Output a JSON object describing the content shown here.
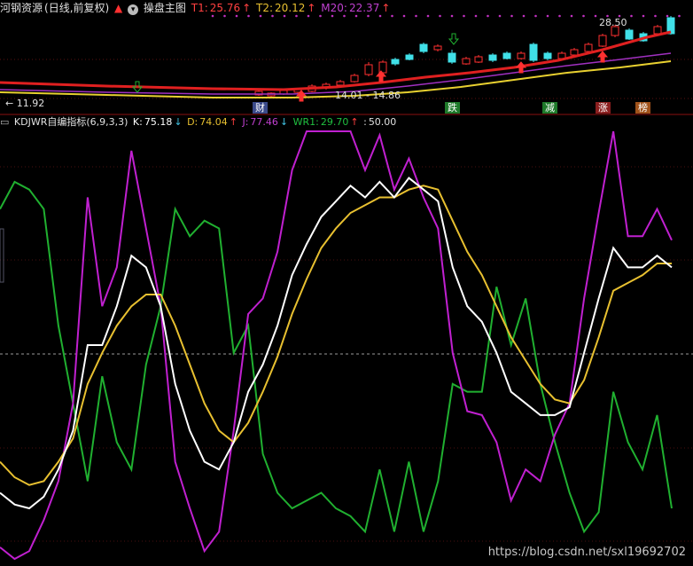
{
  "header": {
    "title": "河钢资源",
    "period": "(日线,前复权)",
    "main_label": "操盘主图",
    "t1_label": "T1:",
    "t1_value": "25.76",
    "t2_label": "T2:",
    "t2_value": "20.12",
    "m20_label": "M20:",
    "m20_value": "22.37"
  },
  "price_annotations": {
    "high_label": "28.50",
    "low_label": "11.92",
    "range_label": "14.01 - 14.86"
  },
  "markers": [
    {
      "text": "财",
      "color": "#3a4a8a"
    },
    {
      "text": "跌",
      "color": "#1e7a2a"
    },
    {
      "text": "减",
      "color": "#1e7a2a"
    },
    {
      "text": "涨",
      "color": "#8a1e1e"
    },
    {
      "text": "榜",
      "color": "#a0521a"
    }
  ],
  "sub_header": {
    "indicator": "KDJWR自编指标(6,9,3,3)",
    "k_label": "K:",
    "k_value": "75.18",
    "d_label": "D:",
    "d_value": "74.04",
    "j_label": "J:",
    "j_value": "77.46",
    "wr_label": "WR1:",
    "wr_value": "29.70",
    "mid_label": ":",
    "mid_value": "50.00"
  },
  "colors": {
    "K": "#ffffff",
    "D": "#e8c030",
    "J": "#c020d0",
    "WR1": "#20b030",
    "ma_red": "#e02020",
    "ma_purple": "#a030c0",
    "ma_yellow": "#e8d030",
    "up_candle": "#ff3030",
    "down_candle": "#40e0e8"
  },
  "chart_data": [
    {
      "type": "line",
      "title": "KDJWR自编指标(6,9,3,3)",
      "ylim": [
        -5,
        105
      ],
      "reference_line": 50,
      "series": [
        {
          "name": "K",
          "values": [
            12,
            9,
            8,
            11,
            18,
            28,
            50,
            50,
            60,
            73,
            70,
            60,
            40,
            28,
            20,
            18,
            25,
            38,
            45,
            55,
            68,
            76,
            83,
            87,
            91,
            88,
            92,
            88,
            93,
            90,
            87,
            70,
            60,
            56,
            48,
            38,
            35,
            32,
            32,
            34,
            48,
            62,
            75,
            70,
            70,
            73,
            70
          ]
        },
        {
          "name": "D",
          "values": [
            20,
            16,
            14,
            15,
            20,
            26,
            40,
            48,
            55,
            60,
            63,
            63,
            55,
            45,
            35,
            28,
            25,
            30,
            38,
            47,
            58,
            67,
            75,
            80,
            84,
            86,
            88,
            88,
            90,
            91,
            90,
            82,
            74,
            68,
            60,
            52,
            46,
            40,
            36,
            35,
            41,
            52,
            64,
            66,
            68,
            71,
            71
          ]
        },
        {
          "name": "J",
          "values": [
            -2,
            -5,
            -3,
            5,
            15,
            35,
            88,
            60,
            70,
            100,
            80,
            60,
            20,
            8,
            -3,
            2,
            28,
            58,
            62,
            74,
            95,
            105,
            105,
            105,
            105,
            95,
            104,
            90,
            98,
            88,
            80,
            48,
            33,
            32,
            25,
            10,
            18,
            15,
            27,
            35,
            62,
            84,
            105,
            78,
            78,
            85,
            77
          ]
        },
        {
          "name": "WR1",
          "values": [
            85,
            92,
            90,
            85,
            55,
            35,
            15,
            42,
            25,
            18,
            45,
            60,
            85,
            78,
            82,
            80,
            48,
            55,
            22,
            12,
            8,
            10,
            12,
            8,
            6,
            2,
            18,
            2,
            20,
            2,
            15,
            40,
            38,
            38,
            65,
            50,
            62,
            40,
            25,
            12,
            2,
            7,
            38,
            25,
            18,
            32,
            8
          ]
        }
      ]
    }
  ]
}
